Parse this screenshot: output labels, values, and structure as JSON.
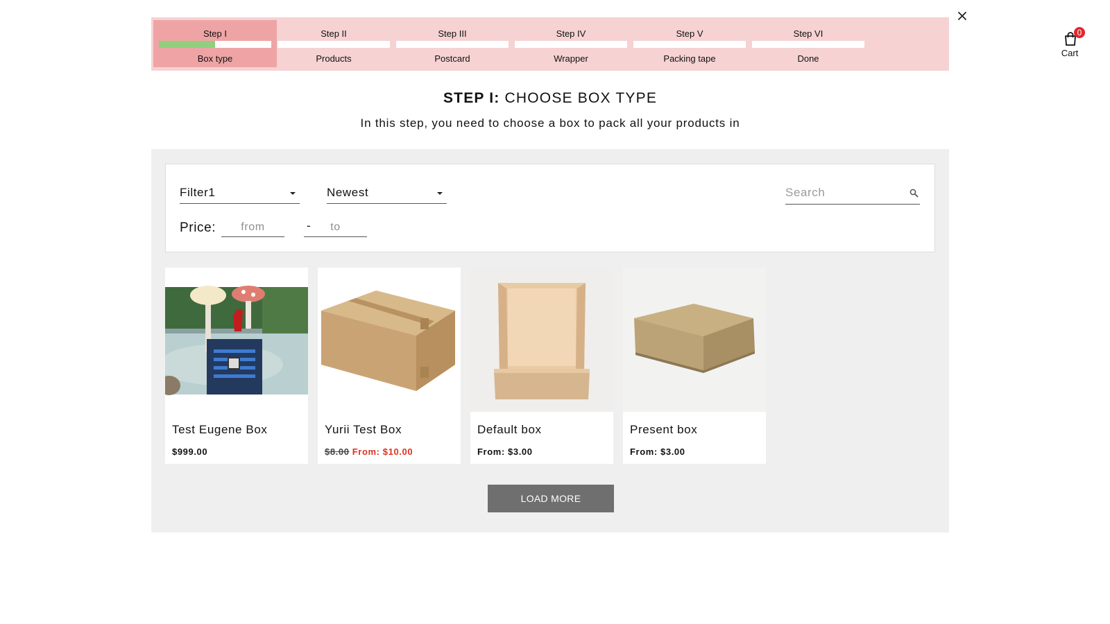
{
  "close_label": "close",
  "steps": [
    {
      "title": "Step I",
      "label": "Box type",
      "active": true,
      "progress": 0.5
    },
    {
      "title": "Step II",
      "label": "Products",
      "active": false,
      "progress": 0
    },
    {
      "title": "Step III",
      "label": "Postcard",
      "active": false,
      "progress": 0
    },
    {
      "title": "Step IV",
      "label": "Wrapper",
      "active": false,
      "progress": 0
    },
    {
      "title": "Step V",
      "label": "Packing tape",
      "active": false,
      "progress": 0
    },
    {
      "title": "Step VI",
      "label": "Done",
      "active": false,
      "progress": 0
    }
  ],
  "cart": {
    "label": "Cart",
    "count": "0",
    "icon": "shopping-bag-icon"
  },
  "heading": {
    "step": "STEP I:",
    "title": "CHOOSE BOX TYPE"
  },
  "subheading": "In this step, you need to choose a box to pack all your products in",
  "filters": {
    "filter1": "Filter1",
    "sort": "Newest",
    "search_placeholder": "Search",
    "price_label": "Price:",
    "from_placeholder": "from",
    "to_placeholder": "to",
    "dash": "-"
  },
  "products": [
    {
      "name": "Test Eugene Box",
      "price": "$999.00",
      "old_price": "",
      "sale_price": ""
    },
    {
      "name": "Yurii Test Box",
      "price": "",
      "old_price": "$8.00",
      "sale_price": "From: $10.00"
    },
    {
      "name": "Default box",
      "price": "From: $3.00",
      "old_price": "",
      "sale_price": ""
    },
    {
      "name": "Present box",
      "price": "From: $3.00",
      "old_price": "",
      "sale_price": ""
    }
  ],
  "load_more": "LOAD MORE",
  "colors": {
    "stepper_bg": "#f6d2d3",
    "step_active": "#eea4a5",
    "progress_fill": "#8fd07e",
    "panel_bg": "#efefef",
    "sale_red": "#e0301e",
    "button_gray": "#6f6f6f"
  }
}
